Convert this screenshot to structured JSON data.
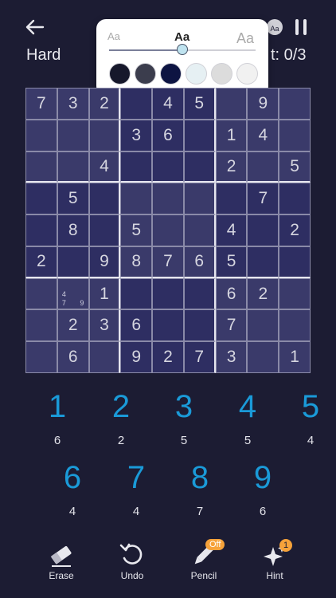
{
  "header": {
    "difficulty": "Hard",
    "mistakes_label": "t: 0/3"
  },
  "popup": {
    "size_small": "Aa",
    "size_medium": "Aa",
    "size_large": "Aa",
    "font_size_level": 0.5,
    "swatches": [
      "#16182b",
      "#3b3d4d",
      "#0d1442",
      "#e6f0f3",
      "#dcdcdc",
      "#f1f1f1"
    ]
  },
  "grid": [
    [
      "7",
      "3",
      "2",
      "",
      "4",
      "5",
      "",
      "9",
      ""
    ],
    [
      "",
      "",
      "",
      "3",
      "6",
      "",
      "1",
      "4",
      ""
    ],
    [
      "",
      "",
      "4",
      "",
      "",
      "",
      "2",
      "",
      "5"
    ],
    [
      "",
      "5",
      "",
      "",
      "",
      "",
      "",
      "7",
      ""
    ],
    [
      "",
      "8",
      "",
      "5",
      "",
      "",
      "4",
      "",
      "2"
    ],
    [
      "2",
      "",
      "9",
      "8",
      "7",
      "6",
      "5",
      "",
      ""
    ],
    [
      "",
      "",
      "1",
      "",
      "",
      "",
      "6",
      "2",
      ""
    ],
    [
      "",
      "2",
      "3",
      "6",
      "",
      "",
      "7",
      "",
      ""
    ],
    [
      "",
      "6",
      "",
      "9",
      "2",
      "7",
      "3",
      "",
      "1"
    ]
  ],
  "notes": {
    "cell_6_1": [
      "4",
      "7",
      "9"
    ]
  },
  "numpad": [
    {
      "digit": "1",
      "count": "6"
    },
    {
      "digit": "2",
      "count": "2"
    },
    {
      "digit": "3",
      "count": "5"
    },
    {
      "digit": "4",
      "count": "5"
    },
    {
      "digit": "5",
      "count": "4"
    },
    {
      "digit": "6",
      "count": "4"
    },
    {
      "digit": "7",
      "count": "4"
    },
    {
      "digit": "8",
      "count": "7"
    },
    {
      "digit": "9",
      "count": "6"
    }
  ],
  "toolbar": {
    "erase": "Erase",
    "undo": "Undo",
    "pencil": "Pencil",
    "pencil_badge": "Off",
    "hint": "Hint",
    "hint_badge": "1"
  }
}
